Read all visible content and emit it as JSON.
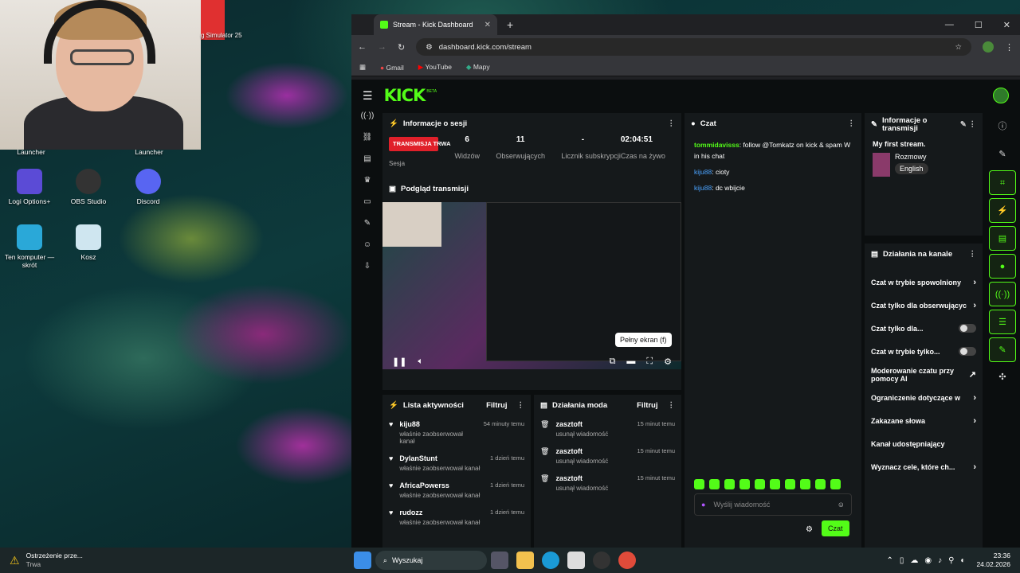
{
  "desktop": {
    "icons": [
      {
        "label": "Launcher"
      },
      {
        "label": "Launcher"
      },
      {
        "label": "Logi Options+"
      },
      {
        "label": "OBS Studio"
      },
      {
        "label": "Discord"
      },
      {
        "label": "Ten komputer — skrót"
      },
      {
        "label": "Kosz"
      }
    ],
    "game_label": "g Simulator 25"
  },
  "browser": {
    "tab_title": "Stream - Kick Dashboard",
    "url": "dashboard.kick.com/stream",
    "bookmarks": [
      "Gmail",
      "YouTube",
      "Mapy"
    ]
  },
  "kick": {
    "logo": "KICK",
    "logo_badge": "BETA",
    "session": {
      "title": "Informacje o sesji",
      "live_badge": "TRANSMISJA TRWA",
      "stats": [
        {
          "value": "6",
          "label": "Widzów"
        },
        {
          "value": "11",
          "label": "Obserwujących"
        },
        {
          "value": "-",
          "label": "Licznik subskrypcji"
        },
        {
          "value": "02:04:51",
          "label": "Czas na żywo"
        }
      ],
      "cut_label": "Sesja"
    },
    "preview": {
      "title": "Podgląd transmisji",
      "tooltip": "Pełny ekran (f)"
    },
    "activity": {
      "title": "Lista aktywności",
      "filter": "Filtruj",
      "items": [
        {
          "name": "kiju88",
          "text": "właśnie zaobserwował kanał",
          "time": "54 minuty temu"
        },
        {
          "name": "DylanStunt",
          "text": "właśnie zaobserwował kanał",
          "time": "1 dzień temu"
        },
        {
          "name": "AfricaPowerss",
          "text": "właśnie zaobserwował kanał",
          "time": "1 dzień temu"
        },
        {
          "name": "rudozz",
          "text": "właśnie zaobserwował kanał",
          "time": "1 dzień temu"
        }
      ]
    },
    "mod": {
      "title": "Działania moda",
      "filter": "Filtruj",
      "items": [
        {
          "name": "zasztoft",
          "text": "usunął wiadomość",
          "time": "15 minut temu"
        },
        {
          "name": "zasztoft",
          "text": "usunął wiadomość",
          "time": "15 minut temu"
        },
        {
          "name": "zasztoft",
          "text": "usunął wiadomość",
          "time": "15 minut temu"
        }
      ]
    },
    "chat": {
      "title": "Czat",
      "messages": [
        {
          "user": "tommidavisss",
          "text": "follow @Tomkatz on kick & spam W in his chat",
          "color": "#53fc18"
        },
        {
          "user": "kiju88",
          "text": "cioty",
          "color": "#4aa3ff"
        },
        {
          "user": "kiju88",
          "text": "dc wbijcie",
          "color": "#4aa3ff"
        }
      ],
      "placeholder": "Wyślij wiadomość",
      "send": "Czat"
    },
    "info": {
      "title": "Informacje o transmisji",
      "stream_title": "My first stream.",
      "category": "Rozmowy",
      "language": "English"
    },
    "channel": {
      "title": "Działania na kanale",
      "items": [
        {
          "label": "Czat w trybie spowolniony",
          "ctrl": "›"
        },
        {
          "label": "Czat tylko dla obserwującyc",
          "ctrl": "›"
        },
        {
          "label": "Czat tylko dla...",
          "ctrl": "toggle"
        },
        {
          "label": "Czat w trybie tylko...",
          "ctrl": "toggle"
        },
        {
          "label": "Moderowanie czatu przy pomocy AI",
          "ctrl": "↗"
        },
        {
          "label": "Ograniczenie dotyczące w",
          "ctrl": "›"
        },
        {
          "label": "Zakazane słowa",
          "ctrl": "›"
        },
        {
          "label": "Kanał udostępniający",
          "ctrl": ""
        },
        {
          "label": "Wyznacz cele, które ch...",
          "ctrl": "›"
        }
      ]
    }
  },
  "taskbar": {
    "warning_title": "Ostrzeżenie prze...",
    "warning_sub": "Trwa",
    "search": "Wyszukaj",
    "time": "23:36",
    "date": "24.02.2026"
  },
  "colors": {
    "kick_green": "#53fc18",
    "live_red": "#e0202a"
  }
}
